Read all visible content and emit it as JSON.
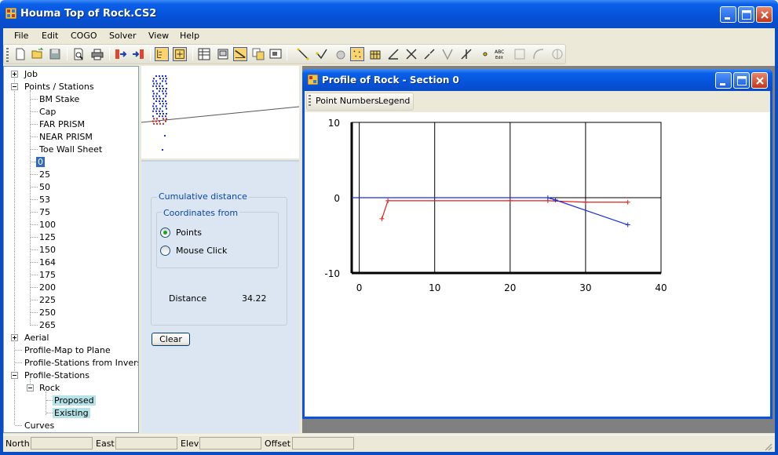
{
  "window": {
    "title": "Houma Top of Rock.CS2"
  },
  "menu": [
    "File",
    "Edit",
    "COGO",
    "Solver",
    "View",
    "Help"
  ],
  "toolbar_icons": [
    "new-file-icon",
    "open-folder-icon",
    "save-icon",
    "print-preview-icon",
    "print-icon",
    "import-icon",
    "export-icon",
    "layer-icon",
    "zoom-extents-icon",
    "grid-table-icon",
    "window-icon",
    "profile-icon",
    "copy-icon",
    "screen-icon",
    "line-tool-icon",
    "check-tool-icon",
    "circle-tool-icon",
    "points-tool-icon",
    "stations-icon",
    "angle-tool-icon",
    "intersect-icon",
    "offset-icon",
    "v-tool-icon",
    "perpendicular-icon",
    "point-tool-icon",
    "text-edit-icon",
    "curve-icon",
    "arc-icon",
    "shape-icon"
  ],
  "tree": {
    "job": "Job",
    "points_stations": "Points / Stations",
    "points": [
      "BM Stake",
      "Cap",
      "FAR PRISM",
      "NEAR PRISM",
      "Toe Wall Sheet"
    ],
    "stations": [
      "0",
      "25",
      "50",
      "53",
      "75",
      "100",
      "125",
      "150",
      "164",
      "175",
      "200",
      "225",
      "250",
      "265"
    ],
    "aerial": "Aerial",
    "profile_map_to_plane": "Profile-Map to Plane",
    "profile_stations_from_inverse": "Profile-Stations from Inverse",
    "profile_stations": "Profile-Stations",
    "rock": "Rock",
    "proposed": "Proposed",
    "existing": "Existing",
    "curves": "Curves"
  },
  "panel": {
    "cumulative_distance": "Cumulative distance",
    "coordinates_from": "Coordinates from",
    "option_points": "Points",
    "option_mouse_click": "Mouse Click",
    "distance_label": "Distance",
    "distance_value": "34.22",
    "clear_button": "Clear"
  },
  "child_window": {
    "title": "Profile of Rock - Section 0",
    "toolbar": {
      "point_numbers": "Point Numbers",
      "legend": "Legend"
    }
  },
  "chart_data": {
    "type": "line",
    "xlim": [
      -1,
      40
    ],
    "ylim": [
      -10,
      10
    ],
    "x_ticks": [
      0,
      10,
      20,
      30,
      40
    ],
    "y_ticks": [
      10,
      0,
      -10
    ],
    "grid": true,
    "series": [
      {
        "color": "#e0201a",
        "x": [
          3,
          3.8,
          20,
          25,
          30,
          35.6
        ],
        "y": [
          -2.8,
          -0.4,
          -0.4,
          -0.4,
          -0.6,
          -0.6
        ]
      },
      {
        "color": "#1a2ce0",
        "x": [
          -1,
          25,
          26,
          35.6
        ],
        "y": [
          0,
          0,
          -0.3,
          -3.6
        ]
      }
    ]
  },
  "statusbar": {
    "north": "North",
    "east": "East",
    "elev": "Elev",
    "offset": "Offset"
  }
}
